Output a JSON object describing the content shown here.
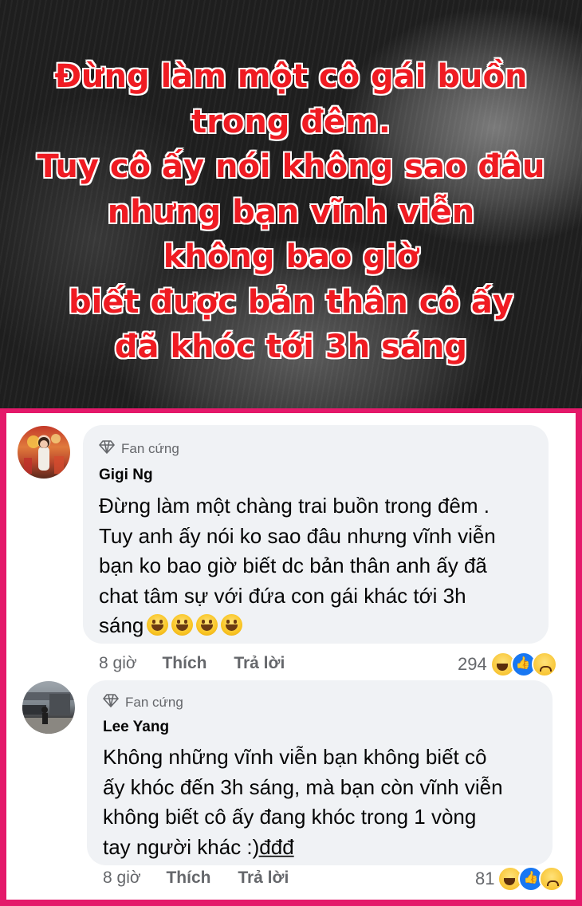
{
  "headline": [
    "Đừng làm một cô gái buồn",
    "trong đêm.",
    "Tuy cô ấy nói không sao đâu",
    "nhưng bạn vĩnh viễn",
    "không bao giờ",
    "biết được bản thân cô ấy",
    "đã khóc tới 3h sáng"
  ],
  "comments": [
    {
      "badge": "Fan cứng",
      "author": "Gigi Ng",
      "lines": [
        "Đừng làm một chàng trai buồn trong đêm .",
        "Tuy anh ấy nói ko sao đâu nhưng vĩnh viễn",
        "bạn ko bao giờ biết dc bản thân anh ấy đã",
        "chat tâm sự với đứa con gái khác tới 3h",
        "sáng"
      ],
      "emoji": "grinning-face",
      "time": "8 giờ",
      "like": "Thích",
      "reply": "Trả lời",
      "reaction_count": "294"
    },
    {
      "badge": "Fan cứng",
      "author": "Lee Yang",
      "lines": [
        "Không những vĩnh viễn bạn không biết cô",
        "ấy khóc đến 3h sáng, mà bạn còn vĩnh viễn",
        "không biết cô ấy đang khóc trong 1 vòng",
        "tay người khác :)đ̲đ̲đ̲"
      ],
      "time": "8 giờ",
      "like": "Thích",
      "reply": "Trả lời",
      "reaction_count": "81"
    }
  ],
  "reaction_icons": [
    "haha-icon",
    "like-icon",
    "sad-icon"
  ],
  "colors": {
    "frame": "#e4196a",
    "headline": "#ef1b22",
    "bubble": "#f0f2f5",
    "meta": "#65676b"
  }
}
